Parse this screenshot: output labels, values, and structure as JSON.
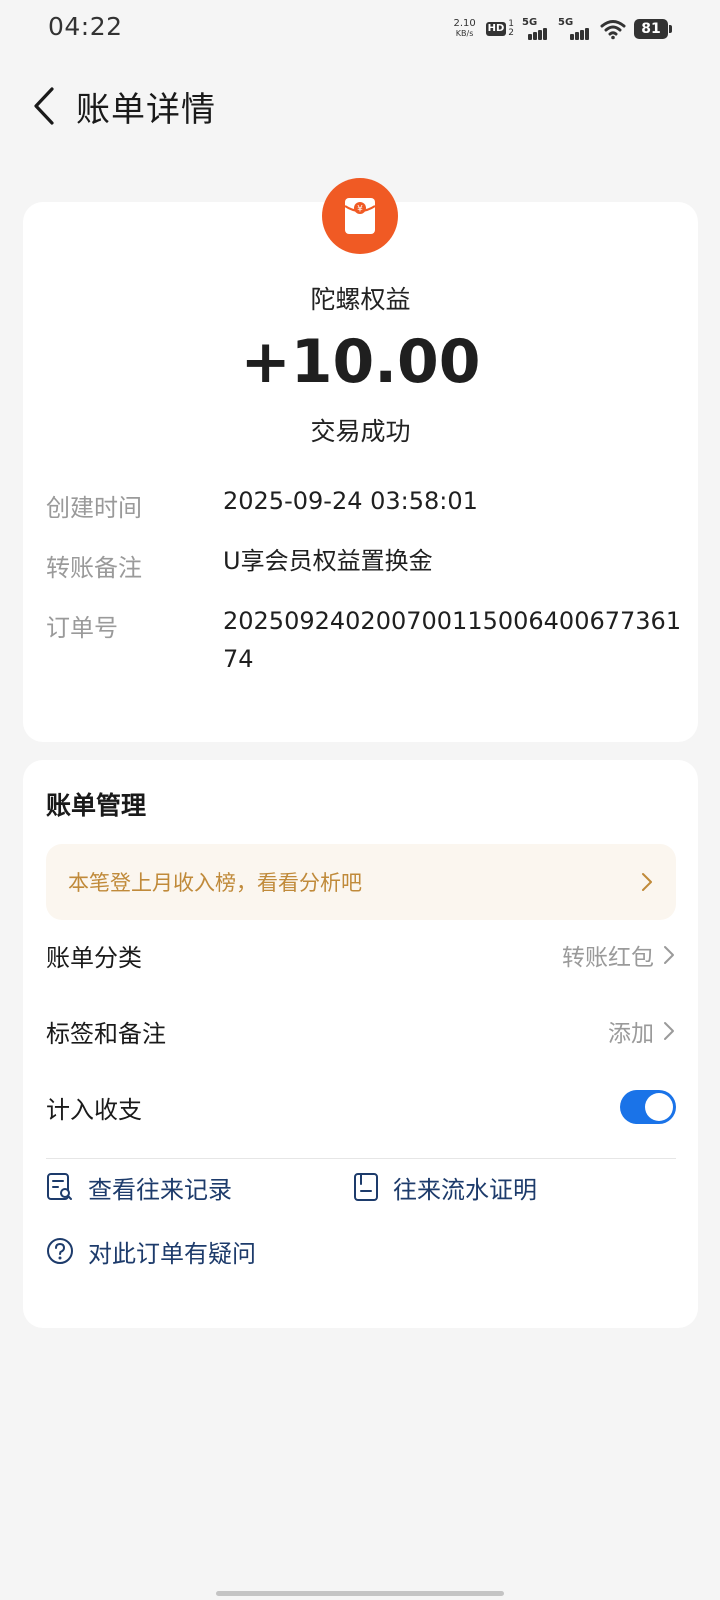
{
  "status_bar": {
    "time": "04:22",
    "net_speed_value": "2.10",
    "net_speed_unit": "KB/s",
    "hd_label": "HD",
    "hd_sup": "1",
    "hd_sub": "2",
    "signal_1_label": "5G",
    "signal_2_label": "5G",
    "battery": "81"
  },
  "nav": {
    "title": "账单详情",
    "back_icon": "chevron-left-icon"
  },
  "transaction": {
    "merchant": "陀螺权益",
    "amount": "+10.00",
    "status": "交易成功",
    "avatar_color": "#f05a24",
    "details": [
      {
        "label": "创建时间",
        "value": "2025-09-24 03:58:01"
      },
      {
        "label": "转账备注",
        "value": "U享会员权益置换金"
      },
      {
        "label": "订单号",
        "value": "20250924020070011500640067736174"
      }
    ]
  },
  "manage": {
    "title": "账单管理",
    "banner_text": "本笔登上月收入榜，看看分析吧",
    "category_label": "账单分类",
    "category_value": "转账红包",
    "tags_label": "标签和备注",
    "tags_value": "添加",
    "count_label": "计入收支",
    "count_enabled": true,
    "links": {
      "records": "查看往来记录",
      "proof": "往来流水证明",
      "question": "对此订单有疑问"
    }
  },
  "colors": {
    "accent": "#1a73e8",
    "link": "#1d3b6b",
    "banner_text": "#c08a3a",
    "banner_bg": "#fbf6ef"
  }
}
